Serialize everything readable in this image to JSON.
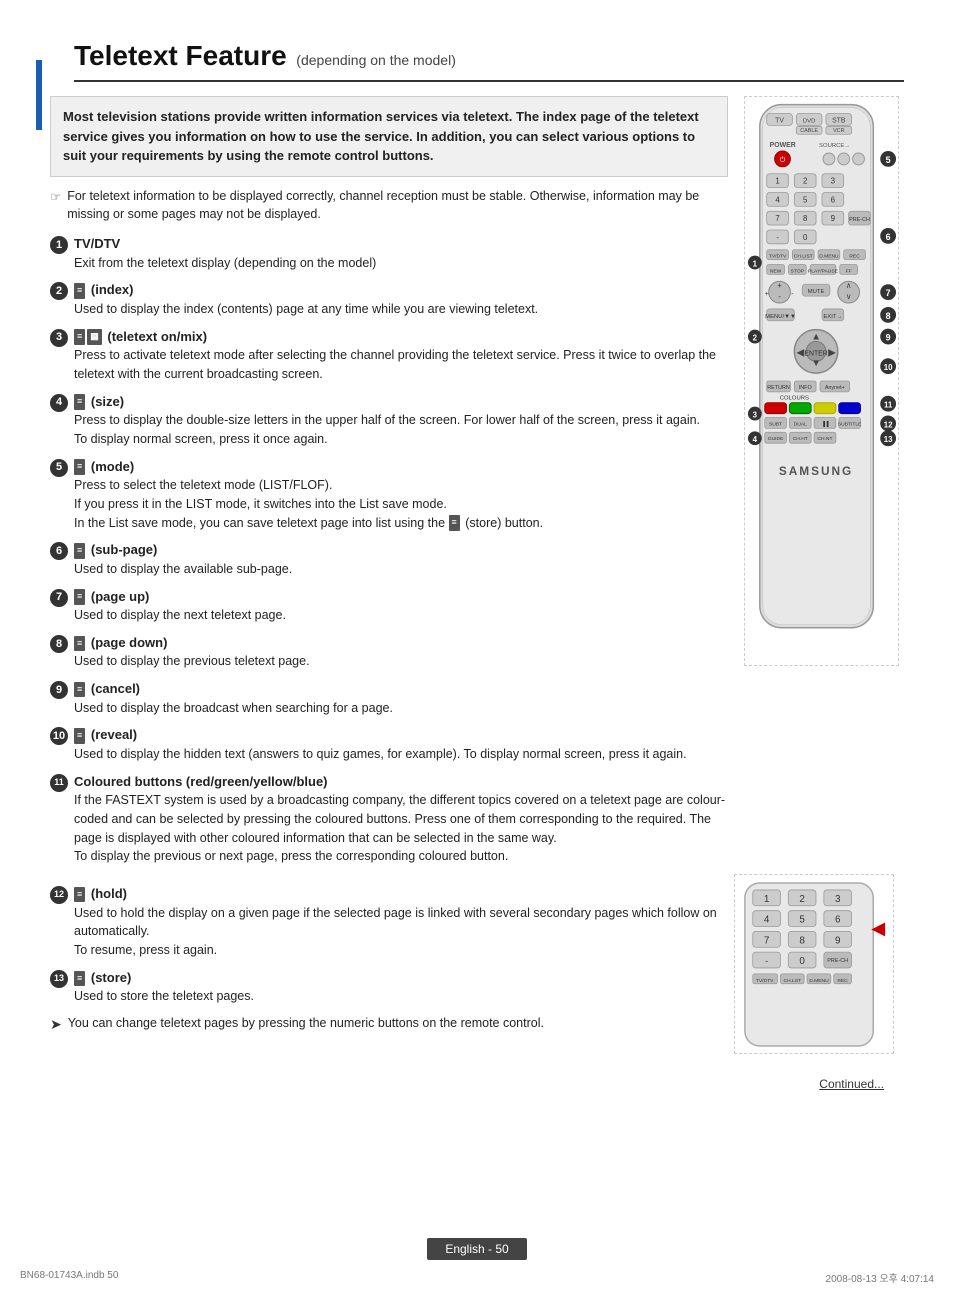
{
  "page": {
    "title": "Teletext Feature",
    "subtitle": "(depending on the model)",
    "intro": "Most television stations provide written information services via teletext. The index page of the teletext service gives you information on how to use the service. In addition, you can select various options to suit your requirements by using the remote control buttons.",
    "note": "For teletext information to be displayed correctly, channel reception must be stable. Otherwise, information may be missing or some pages may not be displayed.",
    "items": [
      {
        "num": "1",
        "title": "TV/DTV",
        "desc": "Exit from the teletext display (depending on the model)"
      },
      {
        "num": "2",
        "icon": "index",
        "title": "(index)",
        "desc": "Used to display the index (contents) page at any time while you are viewing teletext."
      },
      {
        "num": "3",
        "icon": "teletext",
        "title": "(teletext on/mix)",
        "desc": "Press to activate teletext mode after selecting the channel providing the teletext service. Press it twice to overlap the teletext with the current broadcasting screen."
      },
      {
        "num": "4",
        "icon": "size",
        "title": "(size)",
        "desc": "Press to display the double-size letters in the upper half of the screen. For lower half of the screen, press it again.\nTo display normal screen, press it once again."
      },
      {
        "num": "5",
        "icon": "mode",
        "title": "(mode)",
        "desc": "Press to select the teletext mode (LIST/FLOF).\nIf you press it in the LIST mode, it switches into the List save mode.\nIn the List save mode, you can save teletext page into list using the (store) button."
      },
      {
        "num": "6",
        "icon": "sub-page",
        "title": "(sub-page)",
        "desc": "Used to display the available sub-page."
      },
      {
        "num": "7",
        "icon": "page-up",
        "title": "(page up)",
        "desc": "Used to display the next teletext page."
      },
      {
        "num": "8",
        "icon": "page-down",
        "title": "(page down)",
        "desc": "Used to display the previous teletext page."
      },
      {
        "num": "9",
        "icon": "cancel",
        "title": "(cancel)",
        "desc": "Used to display the broadcast when searching for a page."
      },
      {
        "num": "10",
        "icon": "reveal",
        "title": "(reveal)",
        "desc": "Used to display the hidden text (answers to quiz games, for example). To display normal screen, press it again."
      },
      {
        "num": "11",
        "title": "Coloured buttons (red/green/yellow/blue)",
        "desc": "If the FASTEXT system is used by a broadcasting company, the different topics covered on a teletext page are colour-coded and can be selected by pressing the coloured buttons. Press one of them corresponding to the required. The page is displayed with other coloured information that can be selected in the same way.\nTo display the previous or next page, press the corresponding coloured button."
      },
      {
        "num": "12",
        "icon": "hold",
        "title": "(hold)",
        "desc": "Used to hold the display on a given page if the selected page is linked with several secondary pages which follow on automatically.\nTo resume, press it again."
      },
      {
        "num": "13",
        "icon": "store",
        "title": "(store)",
        "desc": "Used to store the teletext pages."
      }
    ],
    "arrow_note": "You can change teletext pages by pressing the numeric buttons on the remote control.",
    "continued": "Continued...",
    "page_number": "English - 50",
    "footer_left": "BN68-01743A.indb   50",
    "footer_right": "2008-08-13   오후 4:07:14"
  }
}
